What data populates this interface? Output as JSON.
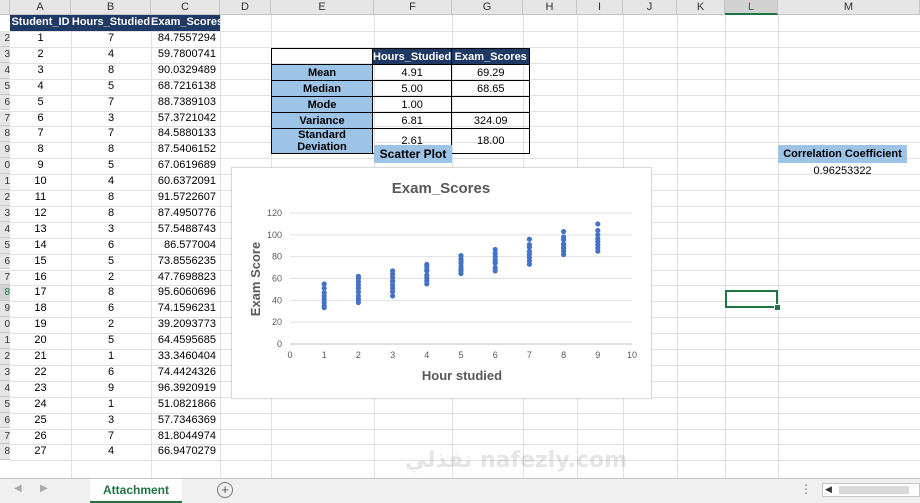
{
  "columns": [
    "A",
    "B",
    "C",
    "D",
    "E",
    "F",
    "G",
    "H",
    "I",
    "J",
    "K",
    "L",
    "M"
  ],
  "selected_column": "L",
  "row_labels": [
    "2",
    "3",
    "4",
    "5",
    "6",
    "7",
    "8",
    "9",
    "0",
    "1",
    "2",
    "3",
    "4",
    "5",
    "6",
    "7",
    "8",
    "9",
    "0",
    "1",
    "2",
    "3",
    "4",
    "5",
    "6",
    "7",
    "8"
  ],
  "table": {
    "headers": [
      "Student_ID",
      "Hours_Studied",
      "Exam_Scores"
    ],
    "rows": [
      [
        "1",
        "7",
        "84.7557294"
      ],
      [
        "2",
        "4",
        "59.7800741"
      ],
      [
        "3",
        "8",
        "90.0329489"
      ],
      [
        "4",
        "5",
        "68.7216138"
      ],
      [
        "5",
        "7",
        "88.7389103"
      ],
      [
        "6",
        "3",
        "57.3721042"
      ],
      [
        "7",
        "7",
        "84.5880133"
      ],
      [
        "8",
        "8",
        "87.5406152"
      ],
      [
        "9",
        "5",
        "67.0619689"
      ],
      [
        "10",
        "4",
        "60.6372091"
      ],
      [
        "11",
        "8",
        "91.5722607"
      ],
      [
        "12",
        "8",
        "87.4950776"
      ],
      [
        "13",
        "3",
        "57.5488743"
      ],
      [
        "14",
        "6",
        "86.577004"
      ],
      [
        "15",
        "5",
        "73.8556235"
      ],
      [
        "16",
        "2",
        "47.7698823"
      ],
      [
        "17",
        "8",
        "95.6060696"
      ],
      [
        "18",
        "6",
        "74.1596231"
      ],
      [
        "19",
        "2",
        "39.2093773"
      ],
      [
        "20",
        "5",
        "64.4595685"
      ],
      [
        "21",
        "1",
        "33.3460404"
      ],
      [
        "22",
        "6",
        "74.4424326"
      ],
      [
        "23",
        "9",
        "96.3920919"
      ],
      [
        "24",
        "1",
        "51.0821866"
      ],
      [
        "25",
        "3",
        "57.7346369"
      ],
      [
        "26",
        "7",
        "81.8044974"
      ],
      [
        "27",
        "4",
        "66.9470279"
      ]
    ]
  },
  "stats": {
    "headers": [
      "",
      "Hours_Studied",
      "Exam_Scores"
    ],
    "rows": [
      [
        "Mean",
        "4.91",
        "69.29"
      ],
      [
        "Median",
        "5.00",
        "68.65"
      ],
      [
        "Mode",
        "1.00",
        ""
      ],
      [
        "Variance",
        "6.81",
        "324.09"
      ],
      [
        "Standard Deviation",
        "2.61",
        "18.00"
      ]
    ]
  },
  "scatter_label": "Scatter Plot",
  "correlation": {
    "label": "Correlation Coefficient",
    "value": "0.96253322"
  },
  "sheet_tab": "Attachment",
  "add_sheet_icon": "plus-circle-icon",
  "watermark": "نفذلي nafezly.com",
  "colors": {
    "header_navy": "#1f3864",
    "label_blue": "#9dc3e6",
    "excel_green": "#217346",
    "marker": "#4472c4"
  },
  "chart_data": {
    "type": "scatter",
    "title": "Exam_Scores",
    "xlabel": "Hour studied",
    "ylabel": "Exam Score",
    "xlim": [
      0,
      10
    ],
    "ylim": [
      0,
      120
    ],
    "xticks": [
      0,
      1,
      2,
      3,
      4,
      5,
      6,
      7,
      8,
      9,
      10
    ],
    "yticks": [
      0,
      20,
      40,
      60,
      80,
      100,
      120
    ],
    "grid": "horizontal",
    "series": [
      {
        "x": [
          1,
          1,
          1,
          1,
          1,
          1,
          1,
          1,
          2,
          2,
          2,
          2,
          2,
          2,
          2,
          2,
          2,
          3,
          3,
          3,
          3,
          3,
          3,
          3,
          3,
          3,
          3,
          4,
          4,
          4,
          4,
          4,
          4,
          4,
          4,
          5,
          5,
          5,
          5,
          5,
          5,
          5,
          5,
          6,
          6,
          6,
          6,
          6,
          6,
          6,
          6,
          7,
          7,
          7,
          7,
          7,
          7,
          7,
          7,
          7,
          8,
          8,
          8,
          8,
          8,
          8,
          8,
          8,
          8,
          9,
          9,
          9,
          9,
          9,
          9,
          9,
          9
        ],
        "y": [
          33.3,
          35,
          38,
          41,
          44,
          47,
          51.1,
          55,
          38,
          41,
          44,
          47.8,
          51,
          54,
          57,
          60,
          62,
          44,
          48,
          51,
          54,
          57.4,
          57.5,
          57.7,
          61,
          64,
          67,
          55,
          58,
          60.6,
          63,
          66.9,
          68,
          71,
          73,
          64.5,
          67.1,
          68.7,
          71,
          73.9,
          76,
          78,
          81,
          67,
          70,
          74.2,
          74.4,
          77,
          80,
          83,
          86.6,
          73,
          76,
          79,
          81.8,
          84.6,
          84.8,
          88.7,
          91,
          96,
          82,
          85,
          87.5,
          87.5,
          90,
          91.6,
          95.6,
          98,
          103,
          85,
          88,
          91,
          94,
          96.4,
          100,
          104,
          110
        ]
      }
    ]
  }
}
